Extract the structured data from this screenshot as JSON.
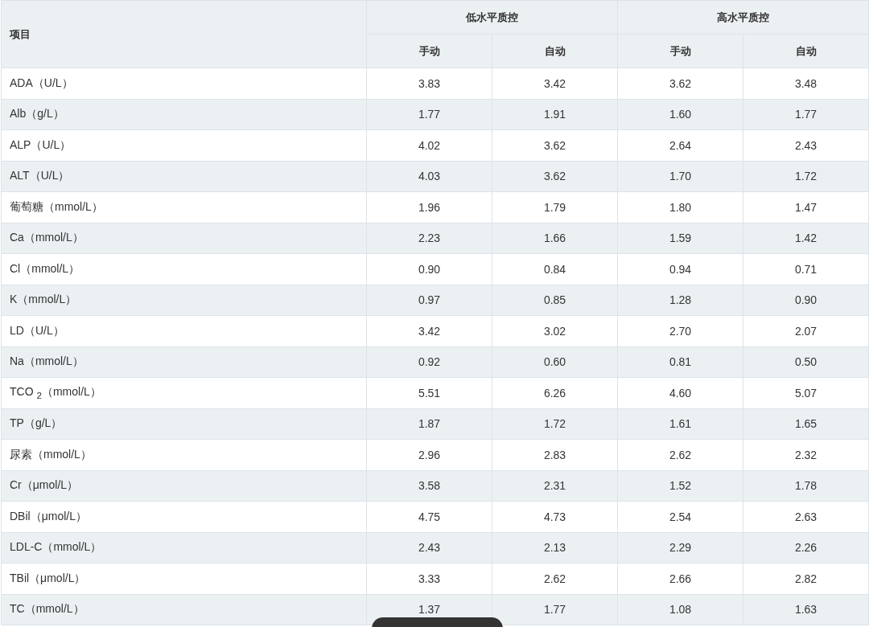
{
  "table": {
    "header": {
      "item": "项目",
      "groups": [
        {
          "label": "低水平质控",
          "columns": [
            "手动",
            "自动"
          ]
        },
        {
          "label": "高水平质控",
          "columns": [
            "手动",
            "自动"
          ]
        }
      ]
    },
    "rows": [
      {
        "item": "ADA（U/L）",
        "values": [
          "3.83",
          "3.42",
          "3.62",
          "3.48"
        ]
      },
      {
        "item": "Alb（g/L）",
        "values": [
          "1.77",
          "1.91",
          "1.60",
          "1.77"
        ]
      },
      {
        "item": "ALP（U/L）",
        "values": [
          "4.02",
          "3.62",
          "2.64",
          "2.43"
        ]
      },
      {
        "item": "ALT（U/L）",
        "values": [
          "4.03",
          "3.62",
          "1.70",
          "1.72"
        ]
      },
      {
        "item": "葡萄糖（mmol/L）",
        "values": [
          "1.96",
          "1.79",
          "1.80",
          "1.47"
        ]
      },
      {
        "item": "Ca（mmol/L）",
        "values": [
          "2.23",
          "1.66",
          "1.59",
          "1.42"
        ]
      },
      {
        "item": "Cl（mmol/L）",
        "values": [
          "0.90",
          "0.84",
          "0.94",
          "0.71"
        ]
      },
      {
        "item": "K（mmol/L）",
        "values": [
          "0.97",
          "0.85",
          "1.28",
          "0.90"
        ]
      },
      {
        "item": "LD（U/L）",
        "values": [
          "3.42",
          "3.02",
          "2.70",
          "2.07"
        ]
      },
      {
        "item": "Na（mmol/L）",
        "values": [
          "0.92",
          "0.60",
          "0.81",
          "0.50"
        ]
      },
      {
        "item": "TCO $_{2}$（mmol/L）",
        "values": [
          "5.51",
          "6.26",
          "4.60",
          "5.07"
        ]
      },
      {
        "item": "TP（g/L）",
        "values": [
          "1.87",
          "1.72",
          "1.61",
          "1.65"
        ]
      },
      {
        "item": "尿素（mmol/L）",
        "values": [
          "2.96",
          "2.83",
          "2.62",
          "2.32"
        ]
      },
      {
        "item": "Cr（μmol/L）",
        "values": [
          "3.58",
          "2.31",
          "1.52",
          "1.78"
        ]
      },
      {
        "item": "DBil（μmol/L）",
        "values": [
          "4.75",
          "4.73",
          "2.54",
          "2.63"
        ]
      },
      {
        "item": "LDL-C（mmol/L）",
        "values": [
          "2.43",
          "2.13",
          "2.29",
          "2.26"
        ]
      },
      {
        "item": "TBil（μmol/L）",
        "values": [
          "3.33",
          "2.62",
          "2.66",
          "2.82"
        ]
      },
      {
        "item": "TC（mmol/L）",
        "values": [
          "1.37",
          "1.77",
          "1.08",
          "1.63"
        ]
      }
    ]
  }
}
